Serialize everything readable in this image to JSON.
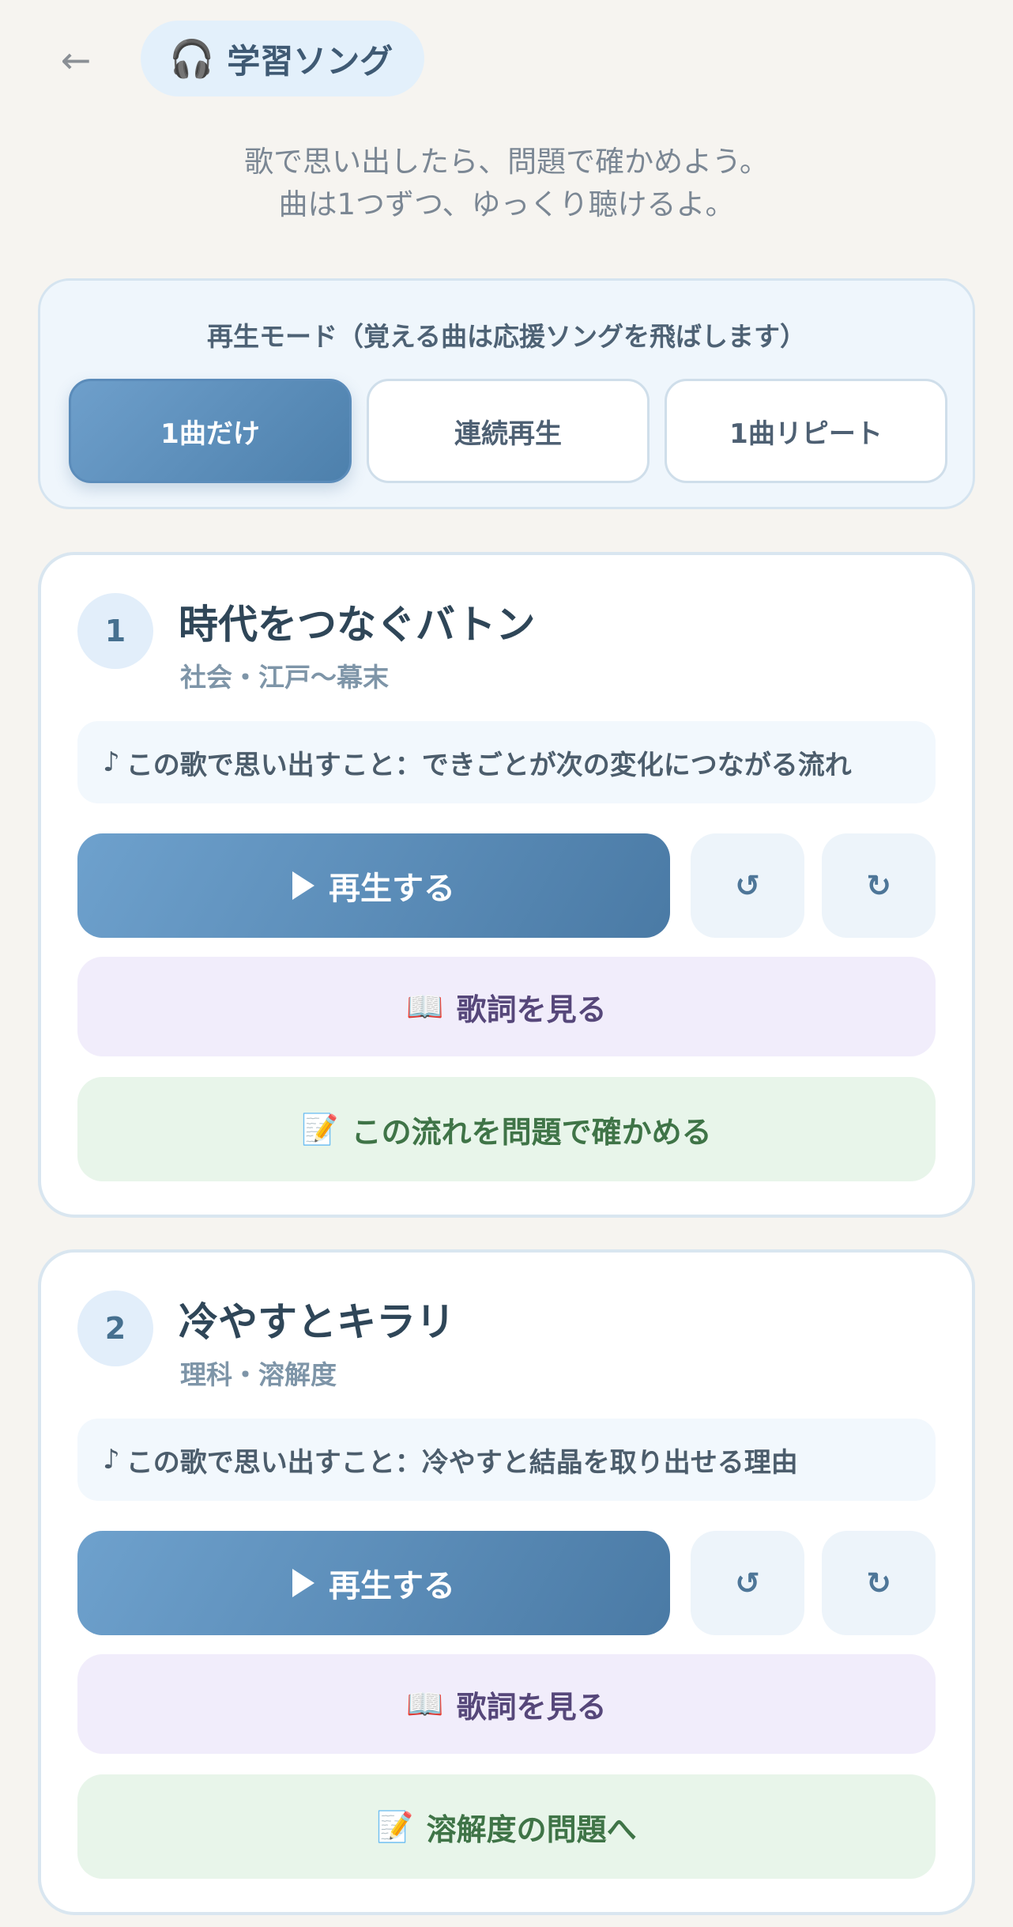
{
  "header": {
    "back_icon": "arrow-left-icon",
    "title_icon": "🎧",
    "title": "学習ソング"
  },
  "intro": {
    "line1": "歌で思い出したら、問題で確かめよう。",
    "line2": "曲は1つずつ、ゆっくり聴けるよ。"
  },
  "mode": {
    "title": "再生モード（覚える曲は応援ソングを飛ばします）",
    "options": [
      {
        "label": "1曲だけ",
        "selected": true
      },
      {
        "label": "連続再生",
        "selected": false
      },
      {
        "label": "1曲リピート",
        "selected": false
      }
    ]
  },
  "songs": [
    {
      "number": "1",
      "title": "時代をつなぐバトン",
      "subtitle": "社会・江戸〜幕末",
      "memo_note": "♪",
      "memo": "この歌で思い出すこと：できごとが次の変化につながる流れ",
      "play_label": "再生する",
      "rewind_symbol": "↺",
      "forward_symbol": "↻",
      "lyrics_emoji": "📖",
      "lyrics_label": "歌詞を見る",
      "check_emoji": "📝",
      "check_label": "この流れを問題で確かめる"
    },
    {
      "number": "2",
      "title": "冷やすとキラリ",
      "subtitle": "理科・溶解度",
      "memo_note": "♪",
      "memo": "この歌で思い出すこと：冷やすと結晶を取り出せる理由",
      "play_label": "再生する",
      "rewind_symbol": "↺",
      "forward_symbol": "↻",
      "lyrics_emoji": "📖",
      "lyrics_label": "歌詞を見る",
      "check_emoji": "📝",
      "check_label": "溶解度の問題へ"
    }
  ],
  "colors": {
    "background": "#f6f4f0",
    "accent": "#5b8cba",
    "lyrics_bg": "#f1edfb",
    "check_bg": "#e8f5ea"
  }
}
